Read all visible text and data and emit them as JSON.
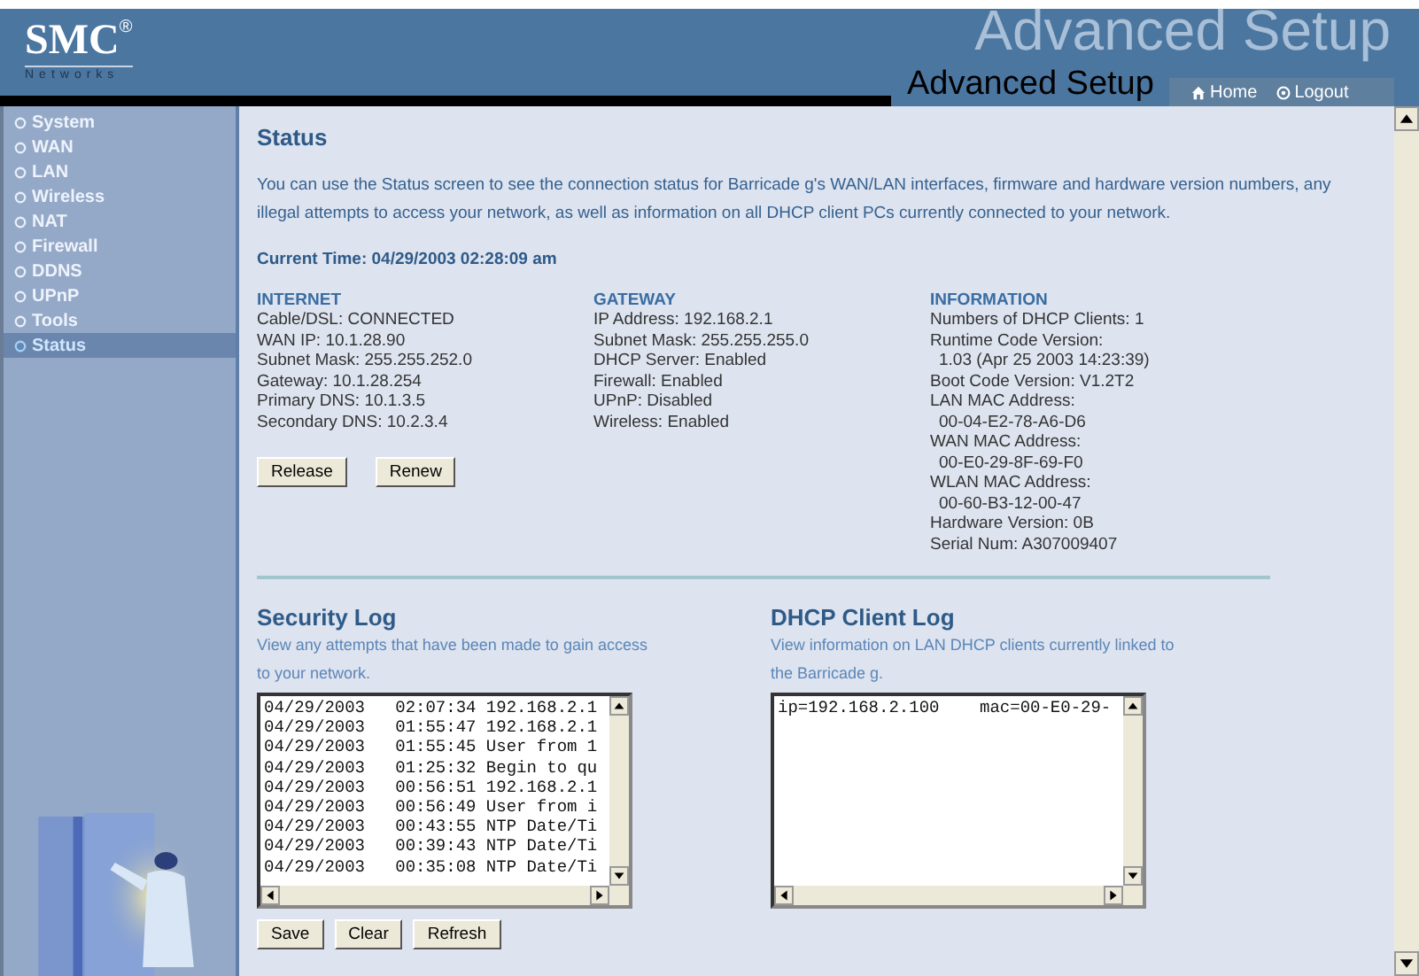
{
  "header": {
    "logo": "SMC",
    "logo_mark": "®",
    "logo_subtitle": "Networks",
    "banner_text": "Advanced Setup",
    "page_title": "Advanced Setup",
    "links": [
      {
        "label": "Home"
      },
      {
        "label": "Logout"
      }
    ]
  },
  "sidebar": {
    "items": [
      {
        "label": "System",
        "selected": false
      },
      {
        "label": "WAN",
        "selected": false
      },
      {
        "label": "LAN",
        "selected": false
      },
      {
        "label": "Wireless",
        "selected": false
      },
      {
        "label": "NAT",
        "selected": false
      },
      {
        "label": "Firewall",
        "selected": false
      },
      {
        "label": "DDNS",
        "selected": false
      },
      {
        "label": "UPnP",
        "selected": false
      },
      {
        "label": "Tools",
        "selected": false
      },
      {
        "label": "Status",
        "selected": true
      }
    ]
  },
  "main": {
    "title": "Status",
    "description": "You can use the Status screen to see the connection status for Barricade g's WAN/LAN interfaces, firmware and hardware version numbers, any illegal attempts to access your network, as well as information on all DHCP client PCs currently connected to your network.",
    "current_time": "Current Time: 04/29/2003 02:28:09 am",
    "sections": [
      {
        "heading": "INTERNET",
        "lines": [
          {
            "text": "Cable/DSL:  CONNECTED",
            "indent": false
          },
          {
            "text": "WAN IP:  10.1.28.90",
            "indent": false
          },
          {
            "text": "Subnet Mask:  255.255.252.0",
            "indent": false
          },
          {
            "text": "Gateway:  10.1.28.254",
            "indent": false
          },
          {
            "text": "Primary DNS:  10.1.3.5",
            "indent": false
          },
          {
            "text": "Secondary DNS:  10.2.3.4",
            "indent": false
          }
        ],
        "buttons": [
          "Release",
          "Renew"
        ]
      },
      {
        "heading": "GATEWAY",
        "lines": [
          {
            "text": "IP Address:  192.168.2.1",
            "indent": false
          },
          {
            "text": "Subnet Mask:  255.255.255.0",
            "indent": false
          },
          {
            "text": "DHCP Server:  Enabled",
            "indent": false
          },
          {
            "text": "Firewall:  Enabled",
            "indent": false
          },
          {
            "text": "UPnP:  Disabled",
            "indent": false
          },
          {
            "text": "Wireless:  Enabled",
            "indent": false
          }
        ]
      },
      {
        "heading": "INFORMATION",
        "lines": [
          {
            "text": "Numbers of DHCP Clients:  1",
            "indent": false
          },
          {
            "text": "Runtime Code Version:",
            "indent": false
          },
          {
            "text": "1.03 (Apr 25 2003 14:23:39)",
            "indent": true
          },
          {
            "text": "Boot Code Version:  V1.2T2",
            "indent": false
          },
          {
            "text": "LAN MAC Address:",
            "indent": false
          },
          {
            "text": "00-04-E2-78-A6-D6",
            "indent": true
          },
          {
            "text": "WAN MAC Address:",
            "indent": false
          },
          {
            "text": "00-E0-29-8F-69-F0",
            "indent": true
          },
          {
            "text": "WLAN MAC Address:",
            "indent": false
          },
          {
            "text": "00-60-B3-12-00-47",
            "indent": true
          },
          {
            "text": "Hardware Version:  0B",
            "indent": false
          },
          {
            "text": "Serial Num:   A307009407",
            "indent": false
          }
        ]
      }
    ],
    "logs": [
      {
        "title": "Security Log",
        "description": "View any attempts that have been made to gain access to your network.",
        "lines": [
          "04/29/2003   02:07:34 192.168.2.1",
          "04/29/2003   01:55:47 192.168.2.1",
          "04/29/2003   01:55:45 User from 1",
          "04/29/2003   01:25:32 Begin to qu",
          "04/29/2003   00:56:51 192.168.2.1",
          "04/29/2003   00:56:49 User from i",
          "04/29/2003   00:43:55 NTP Date/Ti",
          "04/29/2003   00:39:43 NTP Date/Ti",
          "04/29/2003   00:35:08 NTP Date/Ti"
        ],
        "buttons": [
          "Save",
          "Clear",
          "Refresh"
        ]
      },
      {
        "title": "DHCP Client Log",
        "description": "View information on LAN DHCP clients currently linked to the Barricade g.",
        "lines": [
          "ip=192.168.2.100    mac=00-E0-29-"
        ]
      }
    ]
  }
}
